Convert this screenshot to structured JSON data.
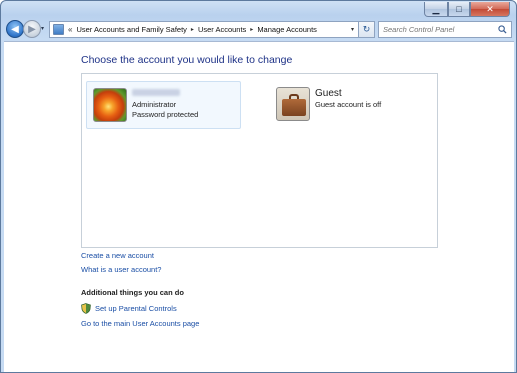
{
  "window": {
    "caption_buttons": {
      "minimize": "▁",
      "maximize": "□",
      "close": "✕"
    }
  },
  "nav": {
    "back_glyph": "◀",
    "forward_glyph": "▶",
    "breadcrumb": {
      "overflow": "«",
      "items": [
        "User Accounts and Family Safety",
        "User Accounts",
        "Manage Accounts"
      ],
      "separator": "▸"
    },
    "address_dropdown_glyph": "▾",
    "refresh_glyph": "↻",
    "search_placeholder": "Search Control Panel"
  },
  "main": {
    "title": "Choose the account you would like to change",
    "accounts": [
      {
        "name_redacted": true,
        "line1": "Administrator",
        "line2": "Password protected",
        "avatar": "flower"
      },
      {
        "name": "Guest",
        "line1": "Guest account is off",
        "avatar": "briefcase"
      }
    ],
    "links": {
      "create_account": "Create a new account",
      "what_is": "What is a user account?"
    },
    "additional": {
      "heading": "Additional things you can do",
      "parental_controls": "Set up Parental Controls",
      "main_page": "Go to the main User Accounts page"
    }
  },
  "colors": {
    "title": "#1e3287",
    "link": "#1a4ea5",
    "accent": "#2f74c9"
  }
}
